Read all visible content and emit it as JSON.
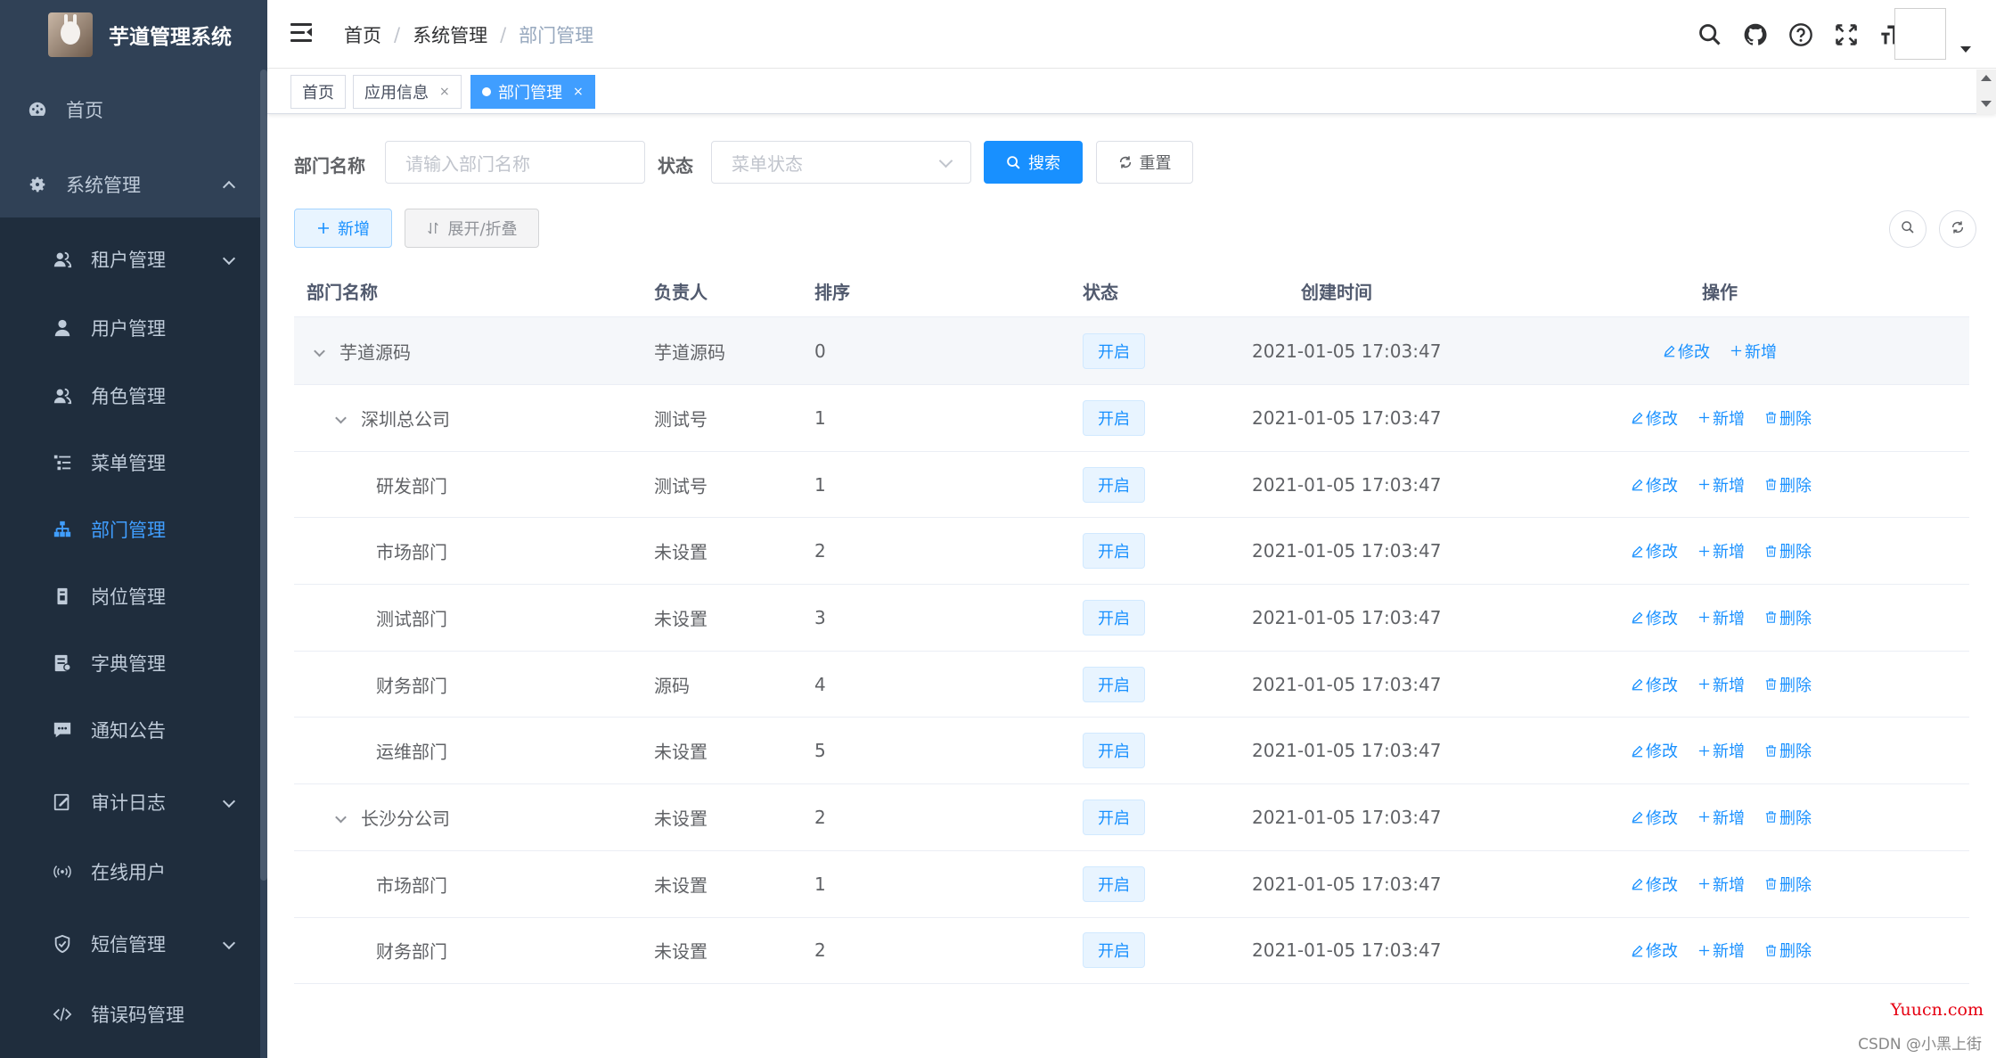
{
  "app": {
    "title": "芋道管理系统"
  },
  "sidebar": {
    "items": [
      {
        "label": "首页",
        "icon": "dashboard-icon"
      },
      {
        "label": "系统管理",
        "icon": "gear-icon"
      },
      {
        "label": "租户管理",
        "icon": "peoples-icon"
      },
      {
        "label": "用户管理",
        "icon": "user-icon"
      },
      {
        "label": "角色管理",
        "icon": "peoples-icon"
      },
      {
        "label": "菜单管理",
        "icon": "tree-table-icon"
      },
      {
        "label": "部门管理",
        "icon": "tree-icon"
      },
      {
        "label": "岗位管理",
        "icon": "post-icon"
      },
      {
        "label": "字典管理",
        "icon": "dict-icon"
      },
      {
        "label": "通知公告",
        "icon": "message-icon"
      },
      {
        "label": "审计日志",
        "icon": "log-icon"
      },
      {
        "label": "在线用户",
        "icon": "online-icon"
      },
      {
        "label": "短信管理",
        "icon": "shield-icon"
      },
      {
        "label": "错误码管理",
        "icon": "code-icon"
      }
    ]
  },
  "breadcrumb": {
    "items": [
      "首页",
      "系统管理",
      "部门管理"
    ],
    "separator": "/"
  },
  "tags": [
    {
      "label": "首页"
    },
    {
      "label": "应用信息",
      "close": "×"
    },
    {
      "label": "部门管理",
      "close": "×"
    }
  ],
  "search": {
    "dept_label": "部门名称",
    "dept_placeholder": "请输入部门名称",
    "status_label": "状态",
    "status_placeholder": "菜单状态",
    "search_btn": "搜索",
    "reset_btn": "重置"
  },
  "toolbar": {
    "add_btn": "新增",
    "expand_btn": "展开/折叠"
  },
  "table": {
    "columns": [
      "部门名称",
      "负责人",
      "排序",
      "状态",
      "创建时间",
      "操作"
    ],
    "rows": [
      {
        "name": "芋道源码",
        "leader": "芋道源码",
        "sort": "0",
        "status": "开启",
        "created": "2021-01-05 17:03:47",
        "edit": "修改",
        "add": "新增"
      },
      {
        "name": "深圳总公司",
        "leader": "测试号",
        "sort": "1",
        "status": "开启",
        "created": "2021-01-05 17:03:47",
        "edit": "修改",
        "add": "新增",
        "delete": "删除"
      },
      {
        "name": "研发部门",
        "leader": "测试号",
        "sort": "1",
        "status": "开启",
        "created": "2021-01-05 17:03:47",
        "edit": "修改",
        "add": "新增",
        "delete": "删除"
      },
      {
        "name": "市场部门",
        "leader": "未设置",
        "sort": "2",
        "status": "开启",
        "created": "2021-01-05 17:03:47",
        "edit": "修改",
        "add": "新增",
        "delete": "删除"
      },
      {
        "name": "测试部门",
        "leader": "未设置",
        "sort": "3",
        "status": "开启",
        "created": "2021-01-05 17:03:47",
        "edit": "修改",
        "add": "新增",
        "delete": "删除"
      },
      {
        "name": "财务部门",
        "leader": "源码",
        "sort": "4",
        "status": "开启",
        "created": "2021-01-05 17:03:47",
        "edit": "修改",
        "add": "新增",
        "delete": "删除"
      },
      {
        "name": "运维部门",
        "leader": "未设置",
        "sort": "5",
        "status": "开启",
        "created": "2021-01-05 17:03:47",
        "edit": "修改",
        "add": "新增",
        "delete": "删除"
      },
      {
        "name": "长沙分公司",
        "leader": "未设置",
        "sort": "2",
        "status": "开启",
        "created": "2021-01-05 17:03:47",
        "edit": "修改",
        "add": "新增",
        "delete": "删除"
      },
      {
        "name": "市场部门",
        "leader": "未设置",
        "sort": "1",
        "status": "开启",
        "created": "2021-01-05 17:03:47",
        "edit": "修改",
        "add": "新增",
        "delete": "删除"
      },
      {
        "name": "财务部门",
        "leader": "未设置",
        "sort": "2",
        "status": "开启",
        "created": "2021-01-05 17:03:47",
        "edit": "修改",
        "add": "新增",
        "delete": "删除"
      }
    ]
  },
  "watermark": {
    "site": "Yuucn.com",
    "author": "CSDN @小黑上街"
  },
  "colors": {
    "sidebar_bg": "#304156",
    "submenu_bg": "#1f2d3d",
    "primary": "#1890ff",
    "active_menu": "#409eff"
  }
}
